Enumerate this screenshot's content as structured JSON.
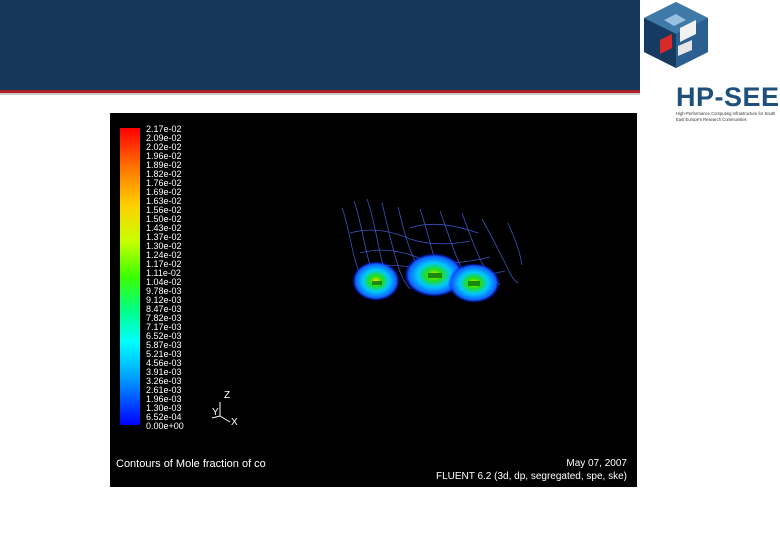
{
  "branding": {
    "name": "HP-SEE",
    "tagline": "High-Performance Computing Infrastructure for South East Europe's Research Communities"
  },
  "visualization": {
    "legend_values": [
      "2.17e-02",
      "2.09e-02",
      "2.02e-02",
      "1.96e-02",
      "1.89e-02",
      "1.82e-02",
      "1.76e-02",
      "1.69e-02",
      "1.63e-02",
      "1.56e-02",
      "1.50e-02",
      "1.43e-02",
      "1.37e-02",
      "1.30e-02",
      "1.24e-02",
      "1.17e-02",
      "1.11e-02",
      "1.04e-02",
      "9.78e-03",
      "9.12e-03",
      "8.47e-03",
      "7.82e-03",
      "7.17e-03",
      "6.52e-03",
      "5.87e-03",
      "5.21e-03",
      "4.56e-03",
      "3.91e-03",
      "3.26e-03",
      "2.61e-03",
      "1.96e-03",
      "1.30e-03",
      "6.52e-04",
      "0.00e+00"
    ],
    "axis_labels": {
      "z": "Z",
      "y": "Y",
      "x": "X"
    },
    "title": "Contours of Mole fraction of co",
    "date": "May 07, 2007",
    "solver": "FLUENT 6.2 (3d, dp, segregated, spe, ske)"
  },
  "colors": {
    "header": "#14375a",
    "accent_red": "#b0202a",
    "background": "#000000"
  }
}
